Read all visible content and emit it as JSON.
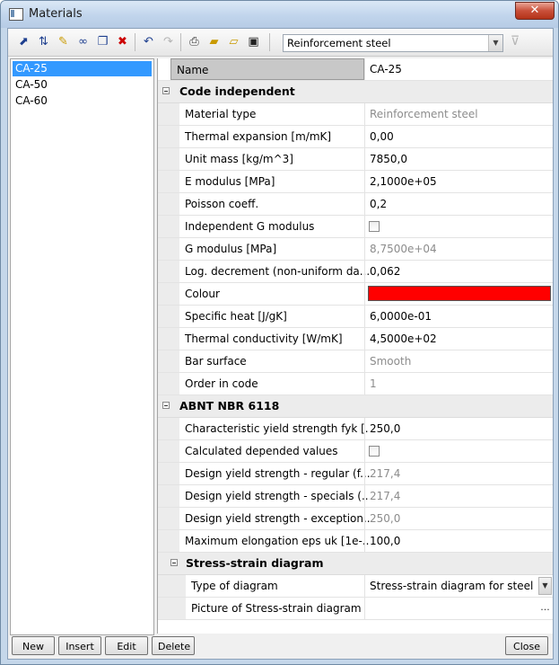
{
  "window": {
    "title": "Materials",
    "close_glyph": "✕"
  },
  "toolbar": {
    "material_type_selected": "Reinforcement steel",
    "icons": [
      "select-icon",
      "sort-icon",
      "edit-icon",
      "binoculars-icon",
      "copy-icon",
      "delete-icon",
      "undo-icon",
      "redo-icon",
      "print-icon",
      "open-icon",
      "open-folder-icon",
      "save-icon",
      "filter-icon"
    ]
  },
  "materials": [
    "CA-25",
    "CA-50",
    "CA-60"
  ],
  "selected_material": "CA-25",
  "properties": {
    "name_label": "Name",
    "name_value": "CA-25",
    "section_code_independent": "Code independent",
    "material_type": {
      "label": "Material type",
      "value": "Reinforcement steel"
    },
    "thermal_expansion": {
      "label": "Thermal expansion  [m/mK]",
      "value": "0,00"
    },
    "unit_mass": {
      "label": "Unit mass [kg/m^3]",
      "value": "7850,0"
    },
    "e_modulus": {
      "label": "E modulus [MPa]",
      "value": "2,1000e+05"
    },
    "poisson": {
      "label": "Poisson coeff.",
      "value": "0,2"
    },
    "independent_g": {
      "label": "Independent G modulus",
      "checked": false
    },
    "g_modulus": {
      "label": "G modulus [MPa]",
      "value": "8,7500e+04"
    },
    "log_decrement": {
      "label": "Log. decrement (non-uniform da...",
      "value": "0,062"
    },
    "colour": {
      "label": "Colour",
      "value": "#ff0000"
    },
    "specific_heat": {
      "label": "Specific heat [J/gK]",
      "value": "6,0000e-01"
    },
    "thermal_conductivity": {
      "label": "Thermal conductivity [W/mK]",
      "value": "4,5000e+02"
    },
    "bar_surface": {
      "label": "Bar surface",
      "value": "Smooth"
    },
    "order_in_code": {
      "label": "Order in code",
      "value": "1"
    },
    "section_code": "ABNT NBR 6118",
    "fyk": {
      "label": "Characteristic yield strength fyk [...",
      "value": "250,0"
    },
    "calculated_values": {
      "label": "Calculated depended values",
      "checked": false
    },
    "fyd_regular": {
      "label": "Design yield strength - regular (f...",
      "value": "217,4"
    },
    "fyd_specials": {
      "label": "Design yield strength - specials (...",
      "value": "217,4"
    },
    "fyd_exceptional": {
      "label": "Design yield strength - exception...",
      "value": "250,0"
    },
    "max_elongation": {
      "label": "Maximum elongation eps uk [1e-...",
      "value": "100,0"
    },
    "section_stress_strain": "Stress-strain diagram",
    "diagram_type": {
      "label": "Type of diagram",
      "value": "Stress-strain diagram for steel"
    },
    "diagram_picture": {
      "label": "Picture of Stress-strain diagram",
      "value": "..."
    }
  },
  "buttons": {
    "new": "New",
    "insert": "Insert",
    "edit": "Edit",
    "delete": "Delete",
    "close": "Close"
  }
}
